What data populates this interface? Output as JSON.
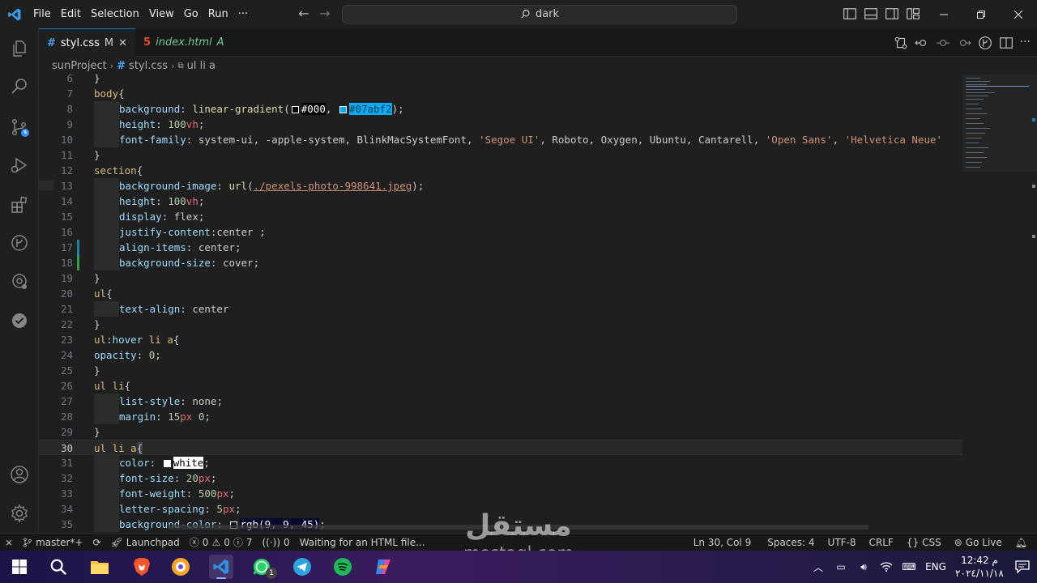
{
  "menu": [
    "File",
    "Edit",
    "Selection",
    "View",
    "Go",
    "Run",
    "···"
  ],
  "search": {
    "text": "dark"
  },
  "tabs": [
    {
      "name": "styl.css",
      "badge": "M",
      "active": true
    },
    {
      "name": "index.html",
      "badge": "A",
      "active": false
    }
  ],
  "breadcrumb": [
    "sunProject",
    "styl.css",
    "ul li a"
  ],
  "code": {
    "l6": "}",
    "l7_sel": "body",
    "l8_prop": "background",
    "l8_fn": "linear-gradient",
    "l8_c1": "#000",
    "l8_c2": "#07abf2",
    "l9_prop": "height",
    "l9_num": "100",
    "l9_unit": "vh",
    "l10_prop": "font-family",
    "l10_val": "system-ui, -apple-system, BlinkMacSystemFont, ",
    "l10_s1": "'Segoe UI'",
    "l10_mid": ", Roboto, Oxygen, Ubuntu, Cantarell, ",
    "l10_s2": "'Open Sans'",
    "l10_s3": "'Helvetica Neue'",
    "l12_sel": "section",
    "l13_prop": "background-image",
    "l13_fn": "url",
    "l13_url": "./pexels-photo-998641.jpeg",
    "l14_prop": "height",
    "l14_num": "100",
    "l14_unit": "vh",
    "l15_prop": "display",
    "l15_val": "flex",
    "l16_prop": "justify-content",
    "l16_val": "center ;",
    "l17_prop": "align-items",
    "l17_val": "center",
    "l18_prop": "background-size",
    "l18_val": "cover",
    "l20_sel": "ul",
    "l21_prop": "text-align",
    "l21_val": "center",
    "l23_sel1": "ul",
    "l23_pseudo": ":hover",
    "l23_sel2": " li a",
    "l24_prop": "opacity",
    "l24_num": "0",
    "l26_sel": "ul li",
    "l27_prop": "list-style",
    "l27_val": "none",
    "l28_prop": "margin",
    "l28_num": "15",
    "l28_unit": "px",
    "l28_num2": "0",
    "l30_sel": "ul li a",
    "l31_prop": "color",
    "l31_val": "white",
    "l32_prop": "font-size",
    "l32_num": "20",
    "l32_unit": "px",
    "l33_prop": "font-weight",
    "l33_num": "500",
    "l33_unit": "px",
    "l34_prop": "letter-spacing",
    "l34_num": "5",
    "l34_unit": "px",
    "l35_prop": "background-color",
    "l35_val": "rgb(9, 9, 45)"
  },
  "line_numbers": [
    "6",
    "7",
    "8",
    "9",
    "10",
    "11",
    "12",
    "13",
    "14",
    "15",
    "16",
    "17",
    "18",
    "19",
    "20",
    "21",
    "22",
    "23",
    "24",
    "25",
    "26",
    "27",
    "28",
    "29",
    "30",
    "31",
    "32",
    "33",
    "34",
    "35"
  ],
  "status": {
    "branch": "master*+",
    "launchpad": "Launchpad",
    "errors": "0",
    "warnings": "0",
    "info": "7",
    "ports": "0",
    "message": "Waiting for an HTML file...",
    "position": "Ln 30, Col 9",
    "spaces": "Spaces: 4",
    "encoding": "UTF-8",
    "eol": "CRLF",
    "language": "CSS",
    "golive": "Go Live"
  },
  "watermark": {
    "arabic": "مستقل",
    "latin": "mostaql.com"
  },
  "taskbar": {
    "lang": "ENG",
    "time": "12:42 م",
    "date": "٢٠٢٤/١١/١٨",
    "whatsapp_badge": "1"
  },
  "colors": {
    "accent": "#0078d4",
    "swatch1": "#000000",
    "swatch2": "#07abf2",
    "swatch3": "#ffffff",
    "swatch4": "#09092d"
  }
}
